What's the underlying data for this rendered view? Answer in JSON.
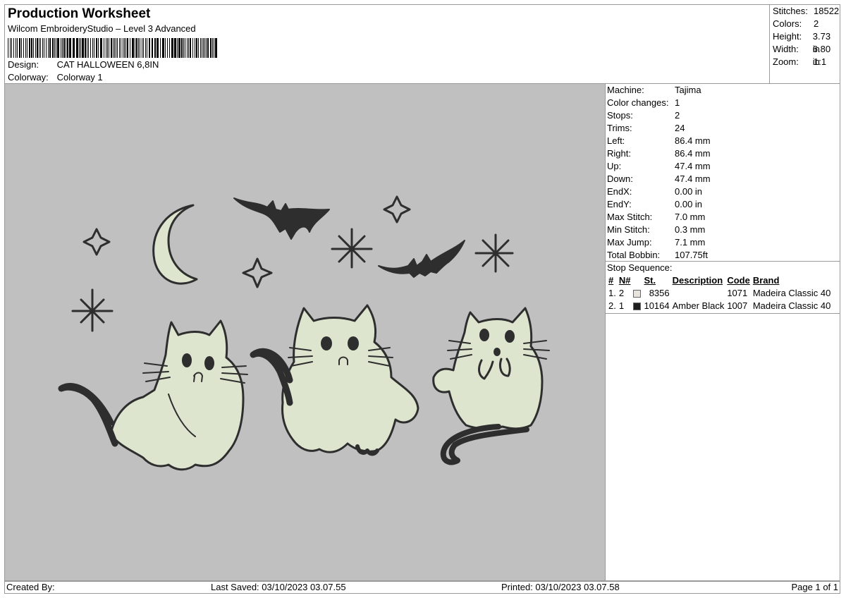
{
  "header": {
    "title": "Production Worksheet",
    "subtitle": "Wilcom EmbroideryStudio – Level 3 Advanced",
    "design_label": "Design:",
    "design_value": "CAT HALLOWEEN 6,8IN",
    "colorway_label": "Colorway:",
    "colorway_value": "Colorway 1"
  },
  "summary": [
    {
      "label": "Stitches:",
      "value": "18522"
    },
    {
      "label": "Colors:",
      "value": "2"
    },
    {
      "label": "Height:",
      "value": "3.73 in"
    },
    {
      "label": "Width:",
      "value": "6.80 in"
    },
    {
      "label": "Zoom:",
      "value": "1:1"
    }
  ],
  "properties": [
    {
      "label": "Machine:",
      "value": "Tajima"
    },
    {
      "label": "Color changes:",
      "value": "1"
    },
    {
      "label": "Stops:",
      "value": "2"
    },
    {
      "label": "Trims:",
      "value": "24"
    },
    {
      "label": "Left:",
      "value": "86.4 mm"
    },
    {
      "label": "Right:",
      "value": "86.4 mm"
    },
    {
      "label": "Up:",
      "value": "47.4 mm"
    },
    {
      "label": "Down:",
      "value": "47.4 mm"
    },
    {
      "label": "EndX:",
      "value": "0.00 in"
    },
    {
      "label": "EndY:",
      "value": "0.00 in"
    },
    {
      "label": "Max Stitch:",
      "value": "7.0 mm"
    },
    {
      "label": "Min Stitch:",
      "value": "0.3 mm"
    },
    {
      "label": "Max Jump:",
      "value": "7.1 mm"
    },
    {
      "label": "Total Bobbin:",
      "value": "107.75ft"
    }
  ],
  "stop_sequence": {
    "caption": "Stop Sequence:",
    "columns": [
      "#",
      "N#",
      "St.",
      "Description",
      "Code",
      "Brand"
    ],
    "rows": [
      {
        "idx": "1.",
        "n": "2",
        "color": "#e6e4dc",
        "st": "8356",
        "description": "",
        "code": "1071",
        "brand": "Madeira Classic 40"
      },
      {
        "idx": "2.",
        "n": "1",
        "color": "#1e1e1e",
        "st": "10164",
        "description": "Amber Black",
        "code": "1007",
        "brand": "Madeira Classic 40"
      }
    ]
  },
  "footer": {
    "created_by": "Created By:",
    "last_saved": "Last Saved: 03/10/2023 03.07.55",
    "printed": "Printed: 03/10/2023 03.07.58",
    "page": "Page 1 of 1"
  },
  "colors": {
    "canvas_bg": "#c0c0c0",
    "fill_light": "#dde5cf",
    "outline": "#2e2e2e"
  }
}
